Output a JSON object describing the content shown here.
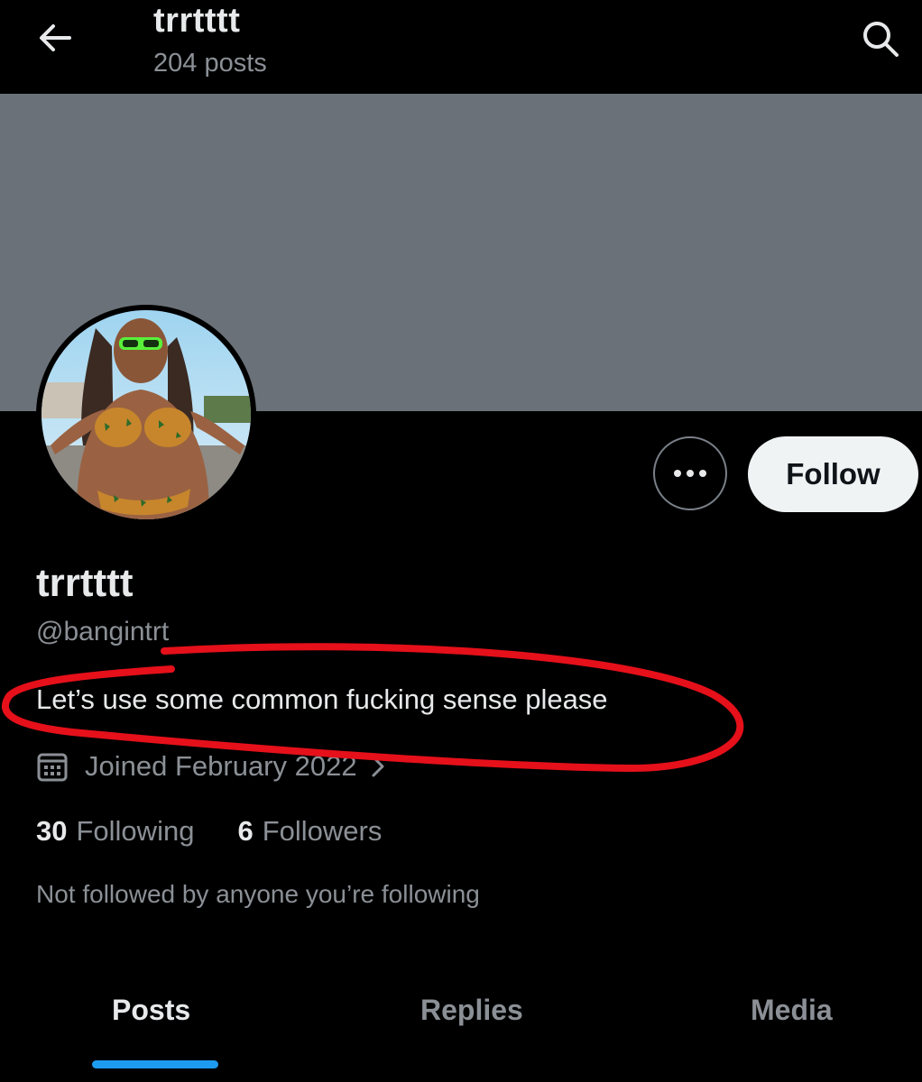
{
  "header": {
    "title": "trrtttt",
    "subtitle": "204 posts",
    "back_icon": "arrow-left-icon",
    "search_icon": "search-icon"
  },
  "profile": {
    "banner_color": "#6a7178",
    "display_name": "trrtttt",
    "handle": "@bangintrt",
    "bio": "Let’s use some common fucking sense please",
    "joined": "Joined February 2022",
    "following_count": "30",
    "following_label": "Following",
    "followers_count": "6",
    "followers_label": "Followers",
    "not_followed_text": "Not followed by anyone you’re following"
  },
  "actions": {
    "more_icon": "more-dots-icon",
    "follow_label": "Follow"
  },
  "tabs": [
    {
      "label": "Posts",
      "active": true
    },
    {
      "label": "Replies",
      "active": false
    },
    {
      "label": "Media",
      "active": false
    }
  ],
  "colors": {
    "background": "#000000",
    "text_primary": "#e7e9ea",
    "text_secondary": "#8b9096",
    "accent": "#1d9bf0",
    "annotation": "#e5101a"
  }
}
